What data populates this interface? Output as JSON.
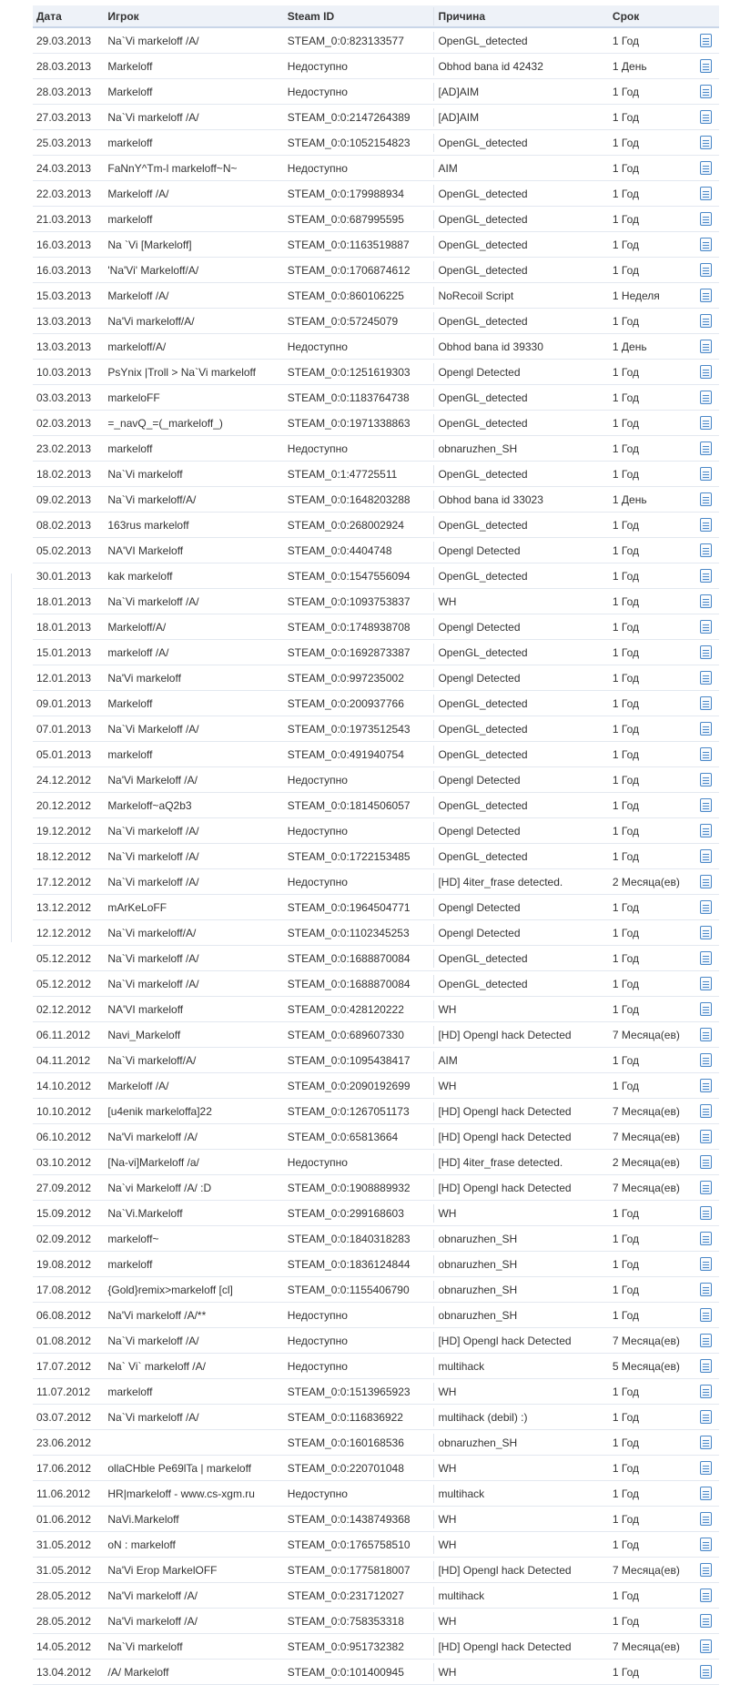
{
  "headers": {
    "date": "Дата",
    "player": "Игрок",
    "steam_id": "Steam ID",
    "reason": "Причина",
    "term": "Срок"
  },
  "rows": [
    {
      "date": "29.03.2013",
      "player": "Na`Vi markeloff /A/",
      "steam_id": "STEAM_0:0:823133577",
      "reason": "OpenGL_detected",
      "term": "1 Год"
    },
    {
      "date": "28.03.2013",
      "player": "Markeloff",
      "steam_id": "Недоступно",
      "reason": "Obhod bana id 42432",
      "term": "1 День"
    },
    {
      "date": "28.03.2013",
      "player": "Markeloff",
      "steam_id": "Недоступно",
      "reason": "[AD]AIM",
      "term": "1 Год"
    },
    {
      "date": "27.03.2013",
      "player": "Na`Vi markeloff /A/",
      "steam_id": "STEAM_0:0:2147264389",
      "reason": "[AD]AIM",
      "term": "1 Год"
    },
    {
      "date": "25.03.2013",
      "player": "markeloff",
      "steam_id": "STEAM_0:0:1052154823",
      "reason": "OpenGL_detected",
      "term": "1 Год"
    },
    {
      "date": "24.03.2013",
      "player": "FaNnY^Tm-l markeloff~N~",
      "steam_id": "Недоступно",
      "reason": "AIM",
      "term": "1 Год"
    },
    {
      "date": "22.03.2013",
      "player": "Markeloff /A/",
      "steam_id": "STEAM_0:0:179988934",
      "reason": "OpenGL_detected",
      "term": "1 Год"
    },
    {
      "date": "21.03.2013",
      "player": "markeloff",
      "steam_id": "STEAM_0:0:687995595",
      "reason": "OpenGL_detected",
      "term": "1 Год"
    },
    {
      "date": "16.03.2013",
      "player": "Na `Vi [Markeloff]",
      "steam_id": "STEAM_0:0:1163519887",
      "reason": "OpenGL_detected",
      "term": "1 Год"
    },
    {
      "date": "16.03.2013",
      "player": "'Na'Vi' Markeloff/A/",
      "steam_id": "STEAM_0:0:1706874612",
      "reason": "OpenGL_detected",
      "term": "1 Год"
    },
    {
      "date": "15.03.2013",
      "player": "Markeloff /A/",
      "steam_id": "STEAM_0:0:860106225",
      "reason": "NoRecoil Script",
      "term": "1 Неделя"
    },
    {
      "date": "13.03.2013",
      "player": "Na'Vi markeloff/A/",
      "steam_id": "STEAM_0:0:57245079",
      "reason": "OpenGL_detected",
      "term": "1 Год"
    },
    {
      "date": "13.03.2013",
      "player": "markeloff/A/",
      "steam_id": "Недоступно",
      "reason": "Obhod bana id 39330",
      "term": "1 День"
    },
    {
      "date": "10.03.2013",
      "player": "PsYnix |Troll > Na`Vi markeloff",
      "steam_id": "STEAM_0:0:1251619303",
      "reason": "Opengl Detected",
      "term": "1 Год"
    },
    {
      "date": "03.03.2013",
      "player": "markeloFF",
      "steam_id": "STEAM_0:0:1183764738",
      "reason": "OpenGL_detected",
      "term": "1 Год"
    },
    {
      "date": "02.03.2013",
      "player": "=_navQ_=(_markeloff_)",
      "steam_id": "STEAM_0:0:1971338863",
      "reason": "OpenGL_detected",
      "term": "1 Год"
    },
    {
      "date": "23.02.2013",
      "player": "markeloff",
      "steam_id": "Недоступно",
      "reason": "obnaruzhen_SH",
      "term": "1 Год"
    },
    {
      "date": "18.02.2013",
      "player": "Na`Vi markeloff",
      "steam_id": "STEAM_0:1:47725511",
      "reason": "OpenGL_detected",
      "term": "1 Год"
    },
    {
      "date": "09.02.2013",
      "player": "Na`Vi markeloff/A/",
      "steam_id": "STEAM_0:0:1648203288",
      "reason": "Obhod bana id 33023",
      "term": "1 День"
    },
    {
      "date": "08.02.2013",
      "player": "163rus markeloff",
      "steam_id": "STEAM_0:0:268002924",
      "reason": "OpenGL_detected",
      "term": "1 Год"
    },
    {
      "date": "05.02.2013",
      "player": "NA'VI Markeloff",
      "steam_id": "STEAM_0:0:4404748",
      "reason": "Opengl Detected",
      "term": "1 Год"
    },
    {
      "date": "30.01.2013",
      "player": "kak markeloff",
      "steam_id": "STEAM_0:0:1547556094",
      "reason": "OpenGL_detected",
      "term": "1 Год"
    },
    {
      "date": "18.01.2013",
      "player": "Na`Vi markeloff /A/",
      "steam_id": "STEAM_0:0:1093753837",
      "reason": "WH",
      "term": "1 Год"
    },
    {
      "date": "18.01.2013",
      "player": "Markeloff/A/",
      "steam_id": "STEAM_0:0:1748938708",
      "reason": "Opengl Detected",
      "term": "1 Год"
    },
    {
      "date": "15.01.2013",
      "player": " markeloff /A/",
      "steam_id": "STEAM_0:0:1692873387",
      "reason": "OpenGL_detected",
      "term": "1 Год"
    },
    {
      "date": "12.01.2013",
      "player": "Na'Vi markeloff",
      "steam_id": "STEAM_0:0:997235002",
      "reason": "Opengl Detected",
      "term": "1 Год"
    },
    {
      "date": "09.01.2013",
      "player": "Markeloff",
      "steam_id": "STEAM_0:0:200937766",
      "reason": "OpenGL_detected",
      "term": "1 Год"
    },
    {
      "date": "07.01.2013",
      "player": "Na`Vi Markeloff /A/",
      "steam_id": "STEAM_0:0:1973512543",
      "reason": "OpenGL_detected",
      "term": "1 Год"
    },
    {
      "date": "05.01.2013",
      "player": "markeloff",
      "steam_id": "STEAM_0:0:491940754",
      "reason": "OpenGL_detected",
      "term": "1 Год"
    },
    {
      "date": "24.12.2012",
      "player": "Na'Vi Markeloff /A/",
      "steam_id": "Недоступно",
      "reason": "Opengl Detected",
      "term": "1 Год"
    },
    {
      "date": "20.12.2012",
      "player": "Markeloff~aQ2b3",
      "steam_id": "STEAM_0:0:1814506057",
      "reason": "OpenGL_detected",
      "term": "1 Год"
    },
    {
      "date": "19.12.2012",
      "player": "Na`Vi markeloff /A/",
      "steam_id": "Недоступно",
      "reason": "Opengl Detected",
      "term": "1 Год"
    },
    {
      "date": "18.12.2012",
      "player": "Na`Vi markeloff /A/",
      "steam_id": "STEAM_0:0:1722153485",
      "reason": "OpenGL_detected",
      "term": "1 Год"
    },
    {
      "date": "17.12.2012",
      "player": "Na`Vi markeloff /A/",
      "steam_id": "Недоступно",
      "reason": "[HD] 4iter_frase detected.",
      "term": "2 Месяца(ев)"
    },
    {
      "date": "13.12.2012",
      "player": "mArKeLoFF",
      "steam_id": "STEAM_0:0:1964504771",
      "reason": "Opengl Detected",
      "term": "1 Год"
    },
    {
      "date": "12.12.2012",
      "player": "Na`Vi markeloff/A/",
      "steam_id": "STEAM_0:0:1102345253",
      "reason": "Opengl Detected",
      "term": "1 Год"
    },
    {
      "date": "05.12.2012",
      "player": "Na`Vi markeloff /A/",
      "steam_id": "STEAM_0:0:1688870084",
      "reason": "OpenGL_detected",
      "term": "1 Год"
    },
    {
      "date": "05.12.2012",
      "player": "Na`Vi markeloff /A/",
      "steam_id": "STEAM_0:0:1688870084",
      "reason": "OpenGL_detected",
      "term": "1 Год"
    },
    {
      "date": "02.12.2012",
      "player": "NA'VI markeloff",
      "steam_id": "STEAM_0:0:428120222",
      "reason": "WH",
      "term": "1 Год"
    },
    {
      "date": "06.11.2012",
      "player": "Navi_Markeloff",
      "steam_id": "STEAM_0:0:689607330",
      "reason": "[HD] Opengl hack Detected",
      "term": "7 Месяца(ев)"
    },
    {
      "date": "04.11.2012",
      "player": "Na`Vi markeloff/A/",
      "steam_id": "STEAM_0:0:1095438417",
      "reason": "AIM",
      "term": "1 Год"
    },
    {
      "date": "14.10.2012",
      "player": "Markeloff /A/",
      "steam_id": "STEAM_0:0:2090192699",
      "reason": "WH",
      "term": "1 Год"
    },
    {
      "date": "10.10.2012",
      "player": "[u4enik markeloffa]22",
      "steam_id": "STEAM_0:0:1267051173",
      "reason": "[HD] Opengl hack Detected",
      "term": "7 Месяца(ев)"
    },
    {
      "date": "06.10.2012",
      "player": "Na'Vi markeloff /A/",
      "steam_id": "STEAM_0:0:65813664",
      "reason": "[HD] Opengl hack Detected",
      "term": "7 Месяца(ев)"
    },
    {
      "date": "03.10.2012",
      "player": "[Na-vi]Markeloff /a/",
      "steam_id": "Недоступно",
      "reason": "[HD] 4iter_frase detected.",
      "term": "2 Месяца(ев)"
    },
    {
      "date": "27.09.2012",
      "player": "Na`vi Markeloff /A/ :D",
      "steam_id": "STEAM_0:0:1908889932",
      "reason": "[HD] Opengl hack Detected",
      "term": "7 Месяца(ев)"
    },
    {
      "date": "15.09.2012",
      "player": "Na`Vi.Markeloff",
      "steam_id": "STEAM_0:0:299168603",
      "reason": "WH",
      "term": "1 Год"
    },
    {
      "date": "02.09.2012",
      "player": "markeloff~",
      "steam_id": "STEAM_0:0:1840318283",
      "reason": "obnaruzhen_SH",
      "term": "1 Год"
    },
    {
      "date": "19.08.2012",
      "player": "markeloff",
      "steam_id": "STEAM_0:0:1836124844",
      "reason": "obnaruzhen_SH",
      "term": "1 Год"
    },
    {
      "date": "17.08.2012",
      "player": "{Gold}remix>markeloff [cl]",
      "steam_id": "STEAM_0:0:1155406790",
      "reason": "obnaruzhen_SH",
      "term": "1 Год"
    },
    {
      "date": "06.08.2012",
      "player": "Na'Vi markeloff /A/**",
      "steam_id": "Недоступно",
      "reason": "obnaruzhen_SH",
      "term": "1 Год"
    },
    {
      "date": "01.08.2012",
      "player": "Na`Vi markeloff /A/",
      "steam_id": "Недоступно",
      "reason": "[HD] Opengl hack Detected",
      "term": "7 Месяца(ев)"
    },
    {
      "date": "17.07.2012",
      "player": "Na` Vi` markeloff /A/",
      "steam_id": "Недоступно",
      "reason": "multihack",
      "term": "5 Месяца(ев)"
    },
    {
      "date": "11.07.2012",
      "player": "markeloff",
      "steam_id": "STEAM_0:0:1513965923",
      "reason": "WH",
      "term": "1 Год"
    },
    {
      "date": "03.07.2012",
      "player": "Na`Vi markeloff /A/",
      "steam_id": "STEAM_0:0:116836922",
      "reason": "multihack (debil) :)",
      "term": "1 Год"
    },
    {
      "date": "23.06.2012",
      "player": "",
      "steam_id": "STEAM_0:0:160168536",
      "reason": "obnaruzhen_SH",
      "term": "1 Год"
    },
    {
      "date": "17.06.2012",
      "player": "ollaCHble Pe69lTa | markeloff",
      "steam_id": "STEAM_0:0:220701048",
      "reason": "WH",
      "term": "1 Год"
    },
    {
      "date": "11.06.2012",
      "player": "HR|markeloff - www.cs-xgm.ru",
      "steam_id": "Недоступно",
      "reason": "multihack",
      "term": "1 Год"
    },
    {
      "date": "01.06.2012",
      "player": "NaVi.Markeloff",
      "steam_id": "STEAM_0:0:1438749368",
      "reason": "WH",
      "term": "1 Год"
    },
    {
      "date": "31.05.2012",
      "player": "oN : markeloff",
      "steam_id": "STEAM_0:0:1765758510",
      "reason": "WH",
      "term": "1 Год"
    },
    {
      "date": "31.05.2012",
      "player": "Na'Vi Erop MarkelOFF",
      "steam_id": "STEAM_0:0:1775818007",
      "reason": "[HD] Opengl hack Detected",
      "term": "7 Месяца(ев)"
    },
    {
      "date": "28.05.2012",
      "player": "Na'Vi markeloff /A/",
      "steam_id": "STEAM_0:0:231712027",
      "reason": "multihack",
      "term": "1 Год"
    },
    {
      "date": "28.05.2012",
      "player": "Na'Vi markeloff /A/",
      "steam_id": "STEAM_0:0:758353318",
      "reason": "WH",
      "term": "1 Год"
    },
    {
      "date": "14.05.2012",
      "player": "Na`Vi markeloff",
      "steam_id": "STEAM_0:0:951732382",
      "reason": "[HD] Opengl hack Detected",
      "term": "7 Месяца(ев)"
    },
    {
      "date": "13.04.2012",
      "player": "/A/ Markeloff",
      "steam_id": "STEAM_0:0:101400945",
      "reason": "WH",
      "term": "1 Год"
    }
  ]
}
